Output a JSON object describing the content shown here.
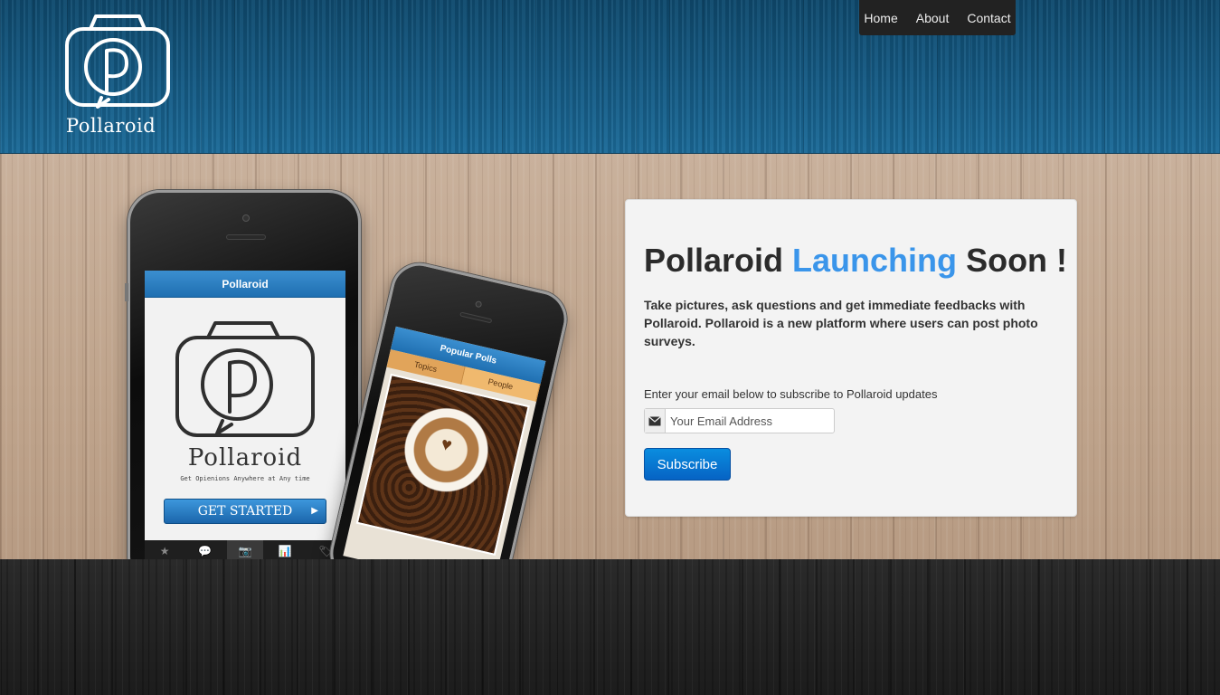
{
  "brand": {
    "name": "Pollaroid"
  },
  "nav": {
    "items": [
      "Home",
      "About",
      "Contact"
    ]
  },
  "phone_main": {
    "header": "Pollaroid",
    "title": "Pollaroid",
    "tagline": "Get Opienions Anywhere at Any time",
    "cta": "GET STARTED",
    "cta_arrow": "▶",
    "tabs": [
      "★",
      "💬",
      "📷",
      "📊",
      "🏷"
    ]
  },
  "phone_second": {
    "header": "Popular Polls",
    "segments": [
      "Topics",
      "People"
    ]
  },
  "panel": {
    "heading_part1": "Pollaroid",
    "heading_accent": "Launching",
    "heading_part2": "Soon !",
    "description": "Take pictures, ask questions and get immediate feedbacks with Pollaroid. Pollaroid is a new platform where users can post photo surveys.",
    "subscribe_hint": "Enter your email below to subscribe to Pollaroid updates",
    "email_placeholder": "Your Email Address",
    "email_value": "",
    "subscribe_label": "Subscribe",
    "icon": "envelope-icon"
  },
  "colors": {
    "accent": "#3a95ea",
    "button": "#0a7bd6",
    "header_blue": "#155b85",
    "wood_light": "#c2a88f",
    "footer_dark": "#222222"
  }
}
